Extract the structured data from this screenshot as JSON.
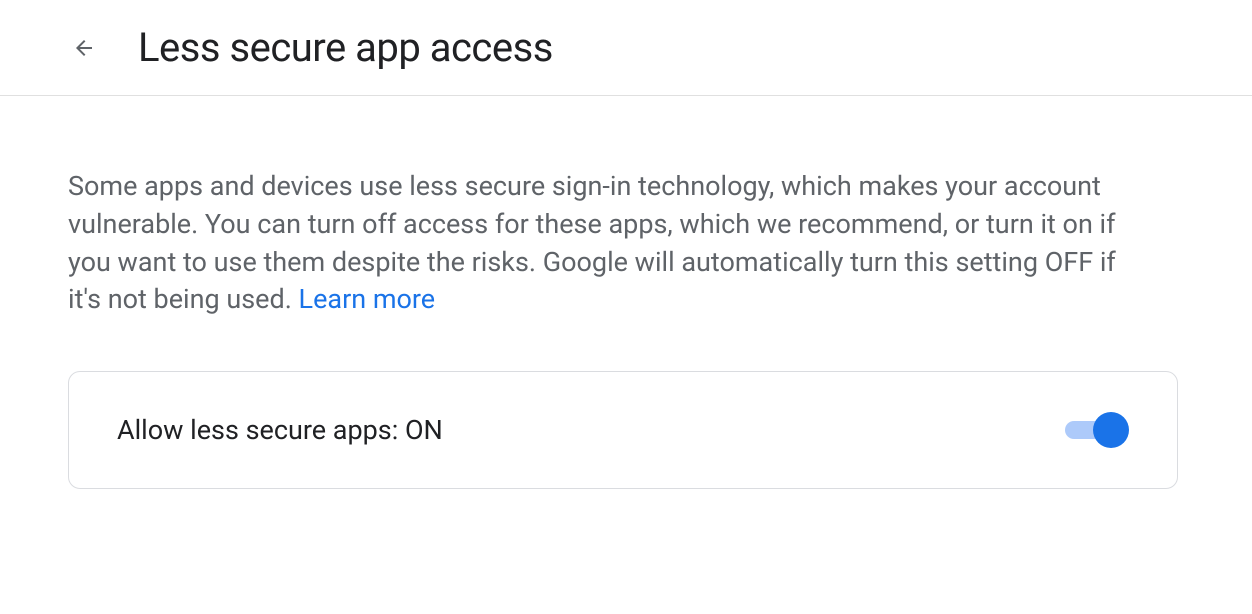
{
  "header": {
    "title": "Less secure app access"
  },
  "content": {
    "description_part1": "Some apps and devices use less secure sign-in technology, which makes your account vulnerable. You can turn off access for these apps, which we recommend, or turn it on if you want to use them despite the risks. Google will automatically turn this setting OFF if it's not being used. ",
    "learn_more_label": "Learn more"
  },
  "setting": {
    "label": "Allow less secure apps: ON",
    "toggle_state": "on"
  }
}
